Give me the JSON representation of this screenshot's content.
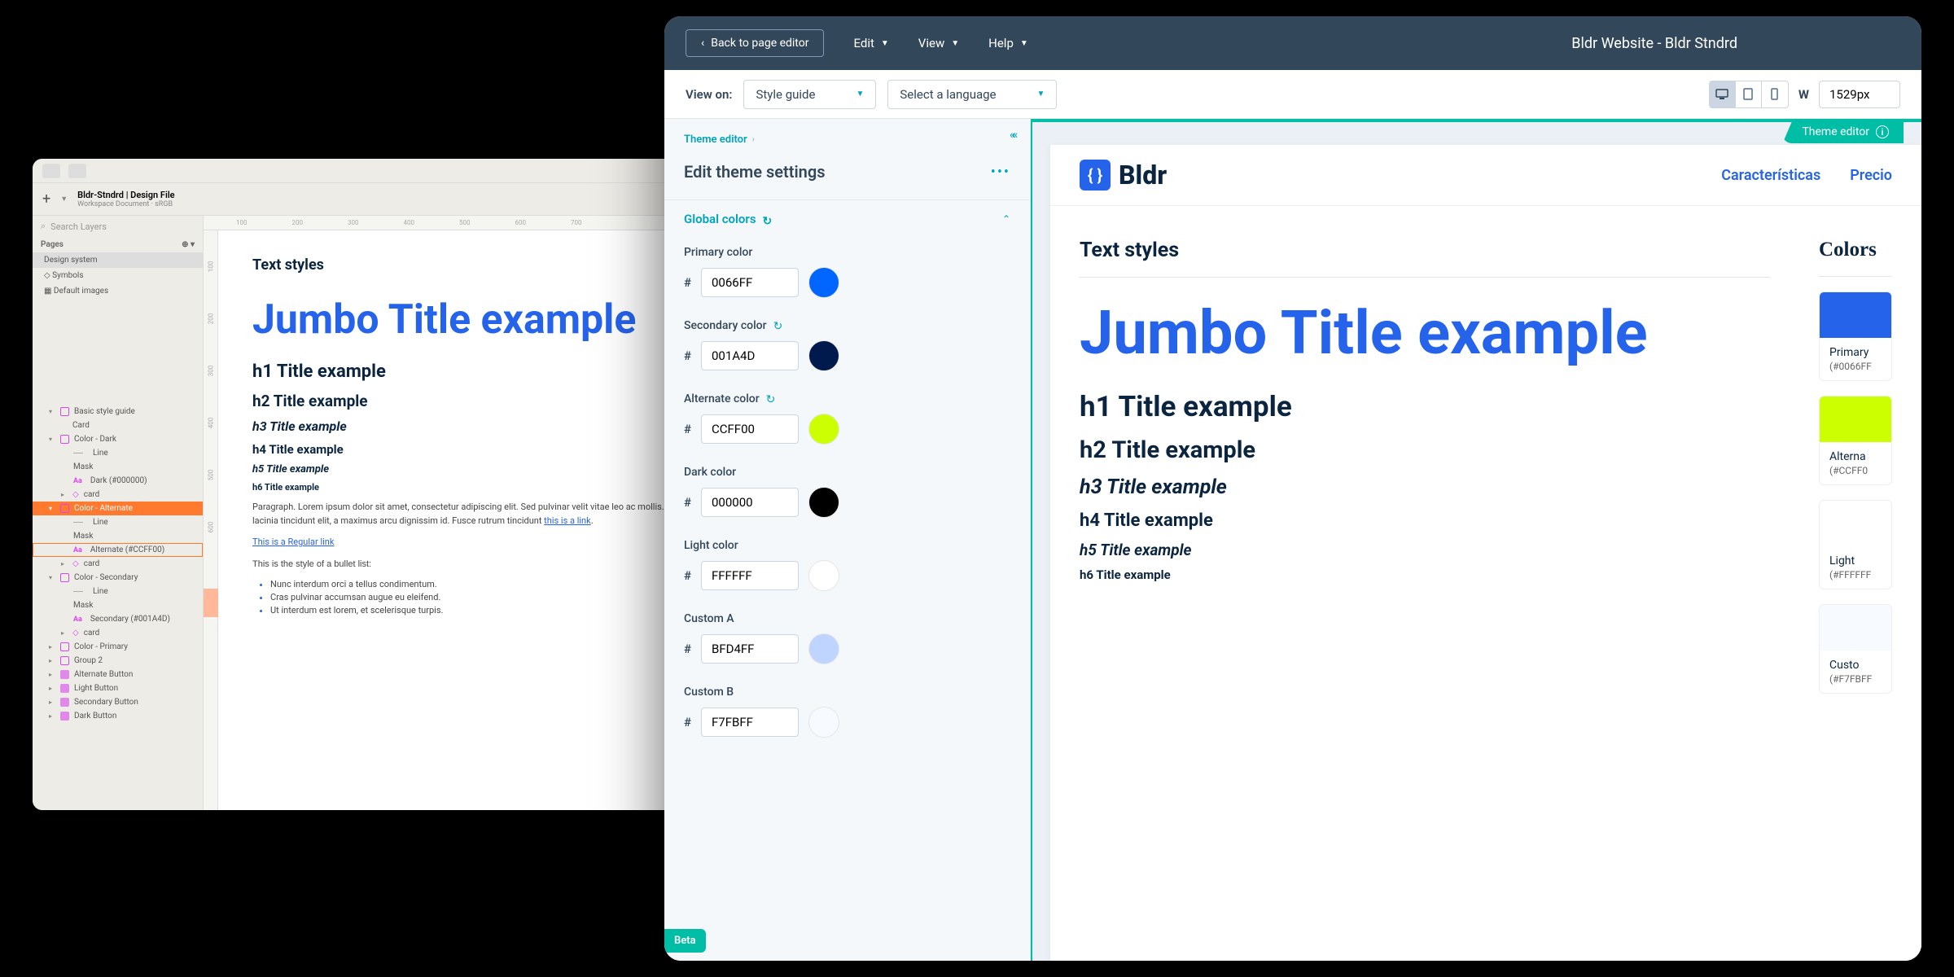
{
  "design_tool": {
    "header": {
      "title": "Bldr-Stndrd | Design File",
      "subtitle": "Workspace Document · sRGB"
    },
    "search_placeholder": "Search Layers",
    "pages_label": "Pages",
    "pages": [
      "Design system",
      "Symbols",
      "Default images"
    ],
    "layers_header": "Basic style guide",
    "layers": [
      {
        "type": "indent1",
        "label": "Card"
      },
      {
        "type": "grp",
        "label": "Color - Dark",
        "expanded": true
      },
      {
        "type": "line",
        "label": "Line"
      },
      {
        "type": "indent2",
        "label": "Mask"
      },
      {
        "type": "txt",
        "label": "Dark (#000000)"
      },
      {
        "type": "indent1",
        "label": "card",
        "icon": "diamond"
      },
      {
        "type": "grp",
        "label": "Color - Alternate",
        "active": true,
        "expanded": true
      },
      {
        "type": "line",
        "label": "Line"
      },
      {
        "type": "indent2",
        "label": "Mask"
      },
      {
        "type": "txt",
        "label": "Alternate (#CCFF00)",
        "outline": true
      },
      {
        "type": "indent1",
        "label": "card",
        "icon": "diamond"
      },
      {
        "type": "grp",
        "label": "Color - Secondary",
        "expanded": true
      },
      {
        "type": "line",
        "label": "Line"
      },
      {
        "type": "indent2",
        "label": "Mask"
      },
      {
        "type": "txt",
        "label": "Secondary (#001A4D)"
      },
      {
        "type": "indent1",
        "label": "card",
        "icon": "diamond"
      },
      {
        "type": "grp",
        "label": "Color - Primary"
      },
      {
        "type": "grp",
        "label": "Group 2"
      },
      {
        "type": "folder",
        "label": "Alternate Button"
      },
      {
        "type": "folder",
        "label": "Light Button"
      },
      {
        "type": "folder",
        "label": "Secondary Button"
      },
      {
        "type": "folder",
        "label": "Dark Button"
      }
    ],
    "ruler_h": [
      "100",
      "200",
      "300",
      "400",
      "500",
      "600",
      "700"
    ],
    "ruler_v": [
      "100",
      "200",
      "300",
      "400",
      "500",
      "600"
    ],
    "art": {
      "section_title": "Text styles",
      "jumbo": "Jumbo Title example",
      "h1": "h1 Title example",
      "h2": "h2 Title example",
      "h3": "h3 Title example",
      "h4": "h4 Title example",
      "h5": "h5 Title example",
      "h6": "h6 Title example",
      "paragraph": "Paragraph. Lorem ipsum dolor sit amet, consectetur adipiscing elit. Sed pulvinar velit vitae leo ac mollis. Praesent lacinia tincidunt elit, a maximus arcu dignissim id. Fusce rutrum tincidunt ",
      "para_link": "this is a link",
      "link_text": "This is a Regular link",
      "bullets_intro": "This is the style of a bullet list:",
      "bullets": [
        "Nunc interdum orci a tellus condimentum.",
        "Cras pulvinar accumsan augue eu eleifend.",
        "Ut interdum est lorem, et scelerisque turpis."
      ]
    }
  },
  "cms": {
    "back": "Back to page editor",
    "menus": [
      "Edit",
      "View",
      "Help"
    ],
    "title": "Bldr Website - Bldr Stndrd",
    "viewon": "View on:",
    "dd1": "Style guide",
    "dd2": "Select a language",
    "width_label": "W",
    "width_value": "1529px",
    "collapse": "««",
    "breadcrumb": "Theme editor",
    "panel_title": "Edit theme settings",
    "accordion": "Global colors",
    "fields": [
      {
        "label": "Primary color",
        "value": "0066FF",
        "hex": "#0066FF",
        "sync": false
      },
      {
        "label": "Secondary color",
        "value": "001A4D",
        "hex": "#001A4D",
        "sync": true
      },
      {
        "label": "Alternate color",
        "value": "CCFF00",
        "hex": "#CCFF00",
        "sync": true
      },
      {
        "label": "Dark color",
        "value": "000000",
        "hex": "#000000",
        "sync": false
      },
      {
        "label": "Light color",
        "value": "FFFFFF",
        "hex": "#FFFFFF",
        "sync": false
      },
      {
        "label": "Custom A",
        "value": "BFD4FF",
        "hex": "#BFD4FF",
        "sync": false
      },
      {
        "label": "Custom B",
        "value": "F7FBFF",
        "hex": "#F7FBFF",
        "sync": false
      }
    ],
    "badge_label": "Theme editor",
    "beta": "Beta"
  },
  "site": {
    "logo": "Bldr",
    "nav": [
      "Características",
      "Precio"
    ],
    "section_title": "Text styles",
    "colors_title": "Colors",
    "jumbo": "Jumbo Title example",
    "h1": "h1 Title example",
    "h2": "h2 Title example",
    "h3": "h3 Title example",
    "h4": "h4 Title example",
    "h5": "h5 Title example",
    "h6": "h6 Title example",
    "color_cards": [
      {
        "name": "Primary",
        "hex": "(#0066FF",
        "bg": "#2563eb"
      },
      {
        "name": "Alterna",
        "hex": "(#CCFF0",
        "bg": "#ccff00"
      },
      {
        "name": "Light",
        "hex": "(#FFFFFF",
        "bg": "#ffffff"
      },
      {
        "name": "Custo",
        "hex": "(#F7FBFF",
        "bg": "#f7fbff"
      }
    ]
  }
}
